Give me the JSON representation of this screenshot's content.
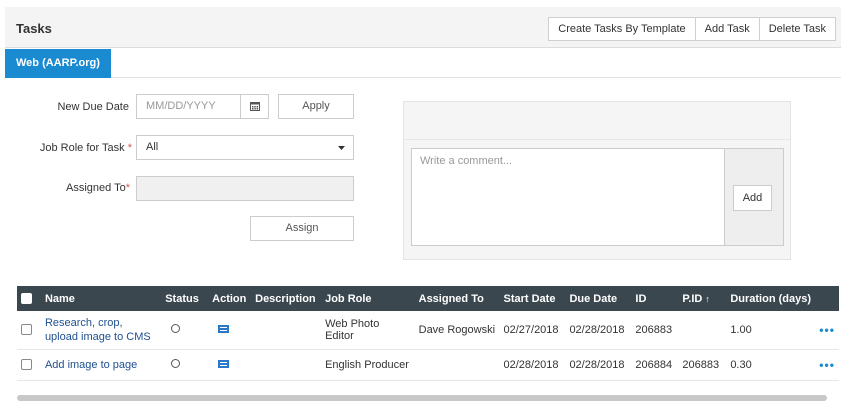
{
  "header": {
    "title": "Tasks",
    "buttons": [
      "Create Tasks By Template",
      "Add Task",
      "Delete Task"
    ]
  },
  "tabs": [
    {
      "label": "Web (AARP.org)",
      "active": true
    }
  ],
  "form": {
    "due_date_label": "New Due Date",
    "due_date_placeholder": "MM/DD/YYYY",
    "apply_label": "Apply",
    "job_role_label": "Job Role for Task",
    "job_role_value": "All",
    "assigned_to_label": "Assigned To",
    "assigned_to_value": "",
    "assign_label": "Assign",
    "required_mark": "*"
  },
  "comment": {
    "placeholder": "Write a comment...",
    "add_label": "Add"
  },
  "table": {
    "headers": [
      "Name",
      "Status",
      "Action",
      "Description",
      "Job Role",
      "Assigned To",
      "Start Date",
      "Due Date",
      "ID",
      "P.ID",
      "Duration (days)"
    ],
    "sort_indicator": "↑",
    "rows": [
      {
        "name": "Research, crop, upload image to CMS",
        "description": "",
        "job_role": "Web Photo Editor",
        "assigned_to": "Dave Rogowski",
        "start_date": "02/27/2018",
        "due_date": "02/28/2018",
        "id": "206883",
        "pid": "",
        "duration": "1.00"
      },
      {
        "name": "Add image to page",
        "description": "",
        "job_role": "English Producer",
        "assigned_to": "",
        "start_date": "02/28/2018",
        "due_date": "02/28/2018",
        "id": "206884",
        "pid": "206883",
        "duration": "0.30"
      }
    ],
    "more_label": "•••"
  },
  "colors": {
    "accent": "#1a8bd1",
    "table_header": "#3b474f",
    "link": "#1f4f8f"
  }
}
